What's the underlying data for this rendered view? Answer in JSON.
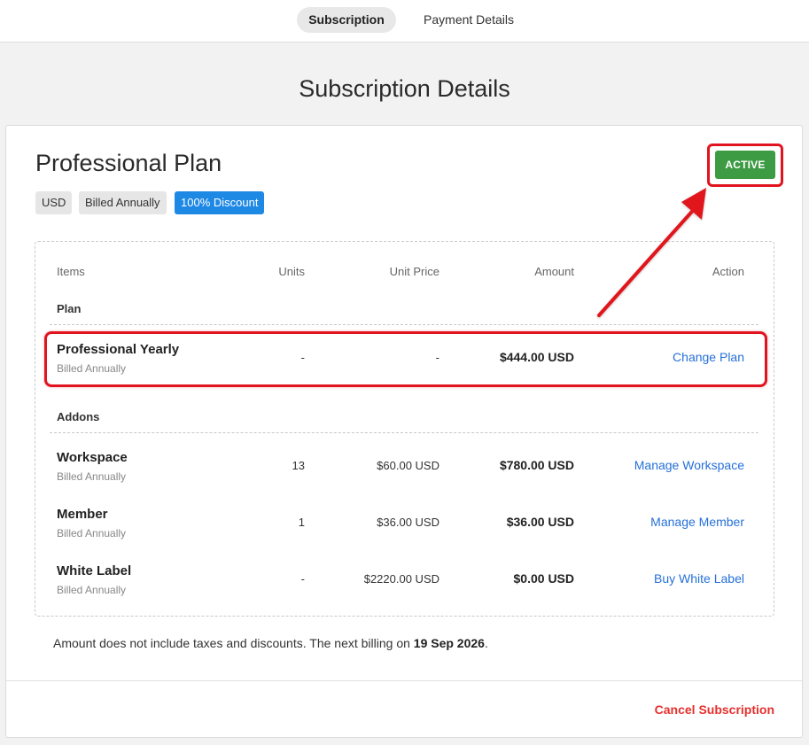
{
  "tabs": {
    "subscription": "Subscription",
    "payment_details": "Payment Details"
  },
  "page_title": "Subscription Details",
  "plan": {
    "title": "Professional Plan",
    "status": "ACTIVE",
    "chips": {
      "currency": "USD",
      "billing": "Billed Annually",
      "discount": "100% Discount"
    }
  },
  "table": {
    "headers": {
      "items": "Items",
      "units": "Units",
      "unit_price": "Unit Price",
      "amount": "Amount",
      "action": "Action"
    },
    "plan_section": "Plan",
    "addons_section": "Addons",
    "plan_row": {
      "name": "Professional Yearly",
      "billing": "Billed Annually",
      "units": "-",
      "unit_price": "-",
      "amount": "$444.00 USD",
      "action": "Change Plan"
    },
    "addons": [
      {
        "name": "Workspace",
        "billing": "Billed Annually",
        "units": "13",
        "unit_price": "$60.00 USD",
        "amount": "$780.00 USD",
        "action": "Manage Workspace"
      },
      {
        "name": "Member",
        "billing": "Billed Annually",
        "units": "1",
        "unit_price": "$36.00 USD",
        "amount": "$36.00 USD",
        "action": "Manage Member"
      },
      {
        "name": "White Label",
        "billing": "Billed Annually",
        "units": "-",
        "unit_price": "$2220.00 USD",
        "amount": "$0.00 USD",
        "action": "Buy White Label"
      }
    ]
  },
  "note": {
    "text": "Amount does not include taxes and discounts. The next billing on ",
    "date": "19 Sep 2026",
    "suffix": "."
  },
  "footer": {
    "cancel_label": "Cancel Subscription"
  },
  "colors": {
    "active_badge": "#3d9b43",
    "discount_chip": "#1e88e5",
    "link": "#2670d8",
    "cancel": "#e5302e",
    "highlight": "#e0141e"
  }
}
